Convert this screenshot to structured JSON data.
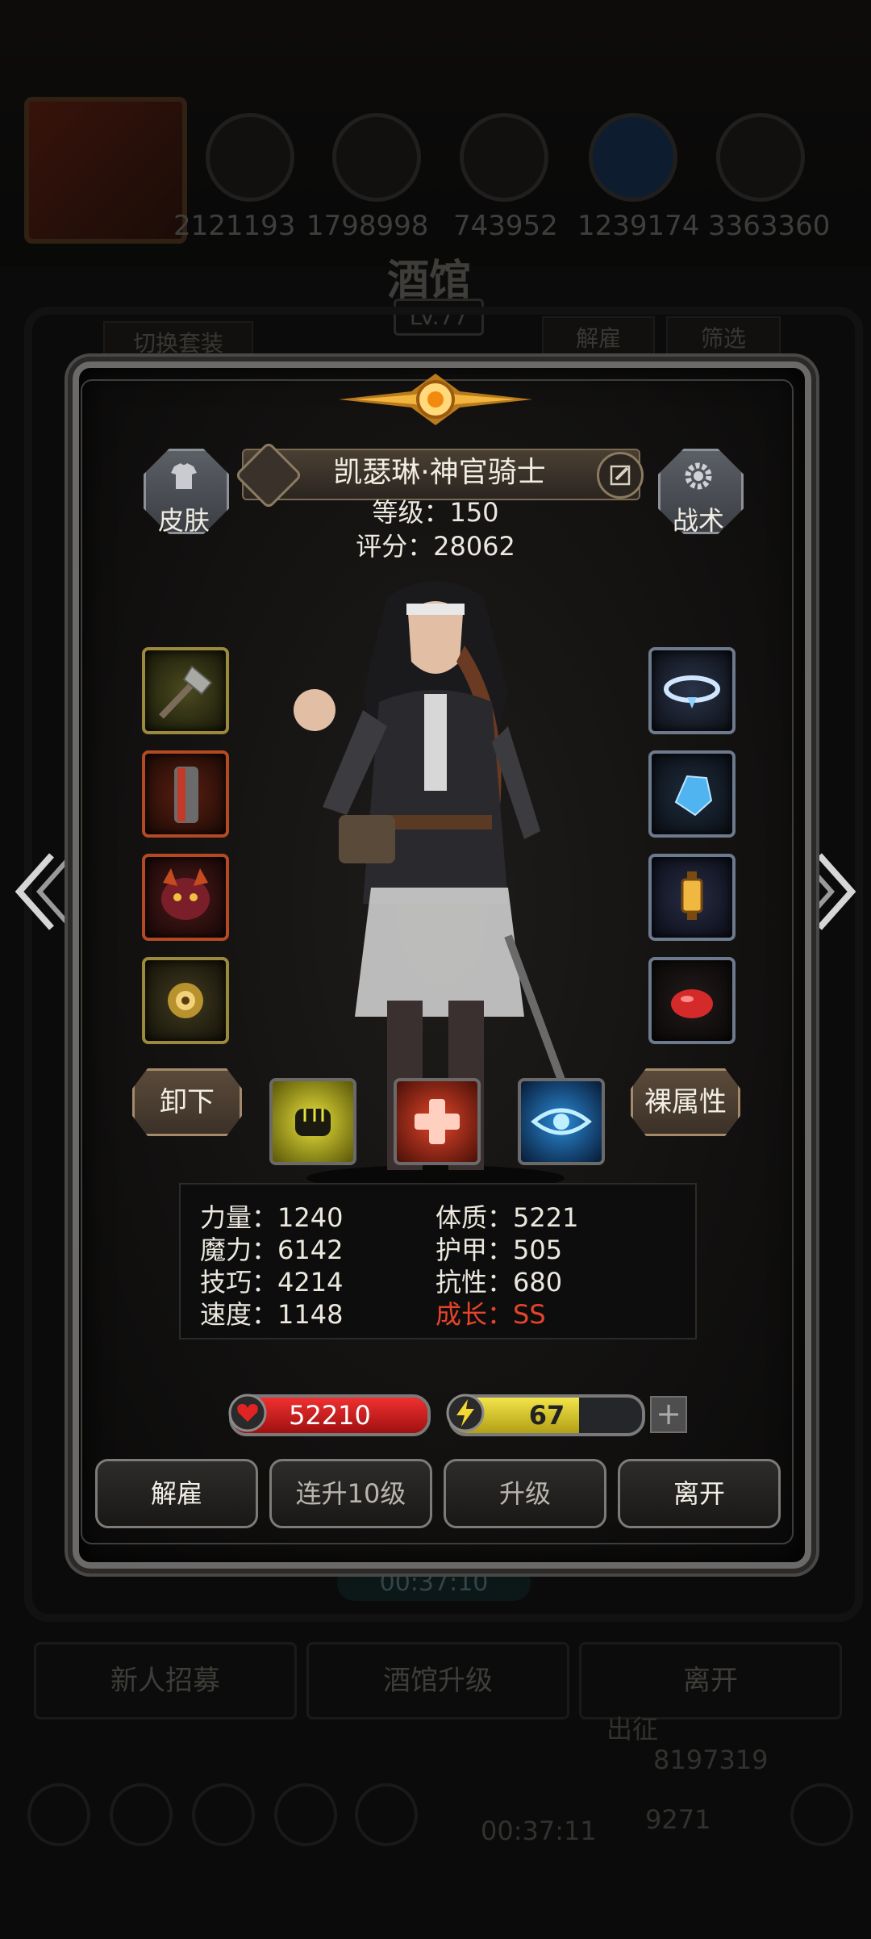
{
  "background": {
    "resource_numbers": [
      "2121193",
      "1798998",
      "743952",
      "1239174",
      "3363360"
    ],
    "tavern_title": "酒馆",
    "tavern_level": "LV.77",
    "switch_outfit": "切换套装",
    "fire_tab": "解雇",
    "filter_tab": "筛选",
    "timer": "00:37:10",
    "bottom_buttons": [
      "新人招募",
      "酒馆升级",
      "离开"
    ],
    "expedition_label": "出征",
    "gold_amount": "8197319",
    "gem_amount": "9271",
    "bottom_timer": "00:37:11"
  },
  "hero": {
    "name": "凯瑟琳·神官骑士",
    "level_line": "等级：150",
    "score_line": "评分：28062"
  },
  "side_buttons": {
    "skin": "皮肤",
    "tactics": "战术"
  },
  "buttons": {
    "unequip": "卸下",
    "base_attributes": "裸属性"
  },
  "stats": {
    "strength": "力量：1240",
    "magic": "魔力：6142",
    "skill": "技巧：4214",
    "speed": "速度：1148",
    "constitution": "体质：5221",
    "armor": "护甲：505",
    "resistance": "抗性：680",
    "growth": "成长：SS"
  },
  "bars": {
    "hp_value": "52210",
    "hp_fraction": 1.0,
    "energy_value": "67",
    "energy_fraction": 0.67
  },
  "actions": {
    "fire": "解雇",
    "level_up_10": "连升10级",
    "level_up": "升级",
    "leave": "离开"
  },
  "colors": {
    "growth": "#e6432a",
    "hp": "#e02020",
    "energy": "#e8d830"
  },
  "icons": {
    "equipment_left": [
      "mace-icon",
      "chest-armor-icon",
      "demon-mask-icon",
      "golden-amulet-icon"
    ],
    "equipment_right": [
      "crystal-tiara-icon",
      "ice-shard-icon",
      "lantern-icon",
      "red-gem-icon"
    ],
    "skills": [
      "fist-icon",
      "heal-cross-icon",
      "eye-icon"
    ]
  }
}
